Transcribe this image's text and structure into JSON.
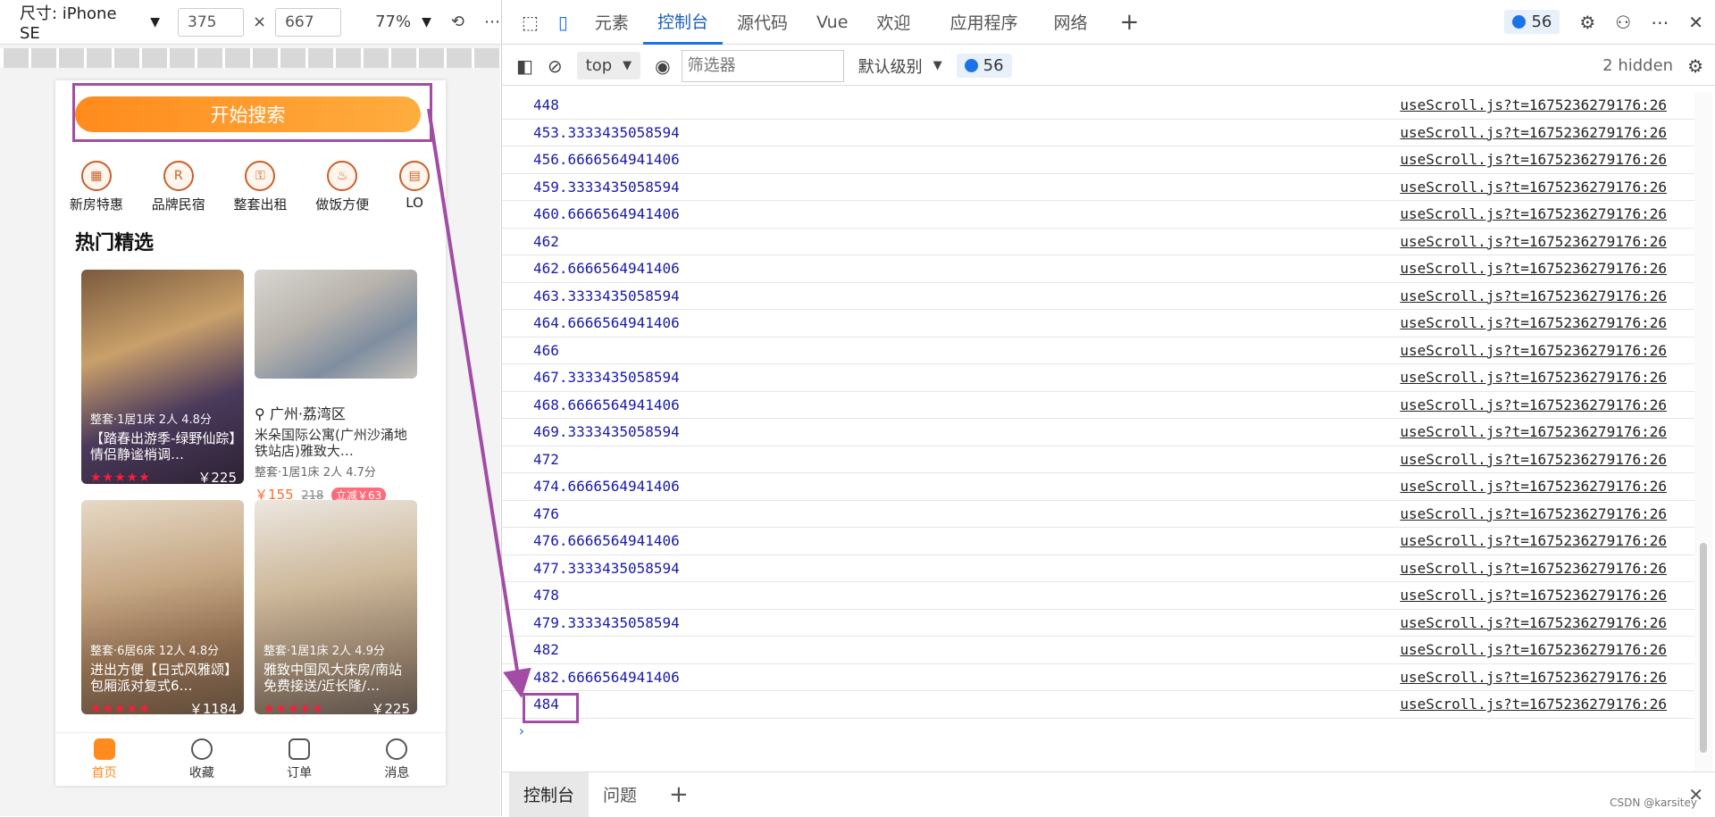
{
  "device_toolbar": {
    "dimensions_label": "尺寸: iPhone SE",
    "width": "375",
    "height": "667",
    "times": "×",
    "zoom": "77%"
  },
  "phone": {
    "search_button": "开始搜索",
    "categories": [
      {
        "label": "新房特惠",
        "icon": "building-icon"
      },
      {
        "label": "品牌民宿",
        "icon": "registered-icon"
      },
      {
        "label": "整套出租",
        "icon": "key-icon"
      },
      {
        "label": "做饭方便",
        "icon": "pot-icon"
      },
      {
        "label": "LO",
        "icon": "loft-icon"
      }
    ],
    "section_title": "热门精选",
    "cards": [
      {
        "meta": "整套·1居1床 2人 4.8分",
        "name": "【踏春出游季-绿野仙踪】情侣静谧梢调…",
        "stars": "★★★★★",
        "price": "￥225"
      },
      {
        "location": "广州·荔湾区",
        "name": "米朵国际公寓(广州沙涌地铁站店)雅致大…",
        "meta": "整套·1居1床 2人 4.7分",
        "price": "￥155",
        "old_price": "218",
        "discount": "立减￥63"
      },
      {
        "meta": "整套·6居6床 12人 4.8分",
        "name": "进出方便【日式风雅颂】包厢派对复式6…",
        "stars": "★★★★★",
        "price": "￥1184"
      },
      {
        "meta": "整套·1居1床 2人 4.9分",
        "name": "雅致中国风大床房/南站免费接送/近长隆/…",
        "stars": "★★★★★",
        "price": "￥225"
      }
    ],
    "tabs": [
      {
        "label": "首页"
      },
      {
        "label": "收藏"
      },
      {
        "label": "订单"
      },
      {
        "label": "消息"
      }
    ]
  },
  "devtools": {
    "tabs": [
      "元素",
      "控制台",
      "源代码",
      "Vue",
      "欢迎",
      "应用程序",
      "网络"
    ],
    "active_tab": "控制台",
    "issues_count": "56",
    "context": "top",
    "filter_placeholder": "筛选器",
    "levels": "默认级别",
    "hidden": "2 hidden",
    "source": "useScroll.js?t=1675236279176:26",
    "logs": [
      "448",
      "453.3333435058594",
      "456.6666564941406",
      "459.3333435058594",
      "460.6666564941406",
      "462",
      "462.6666564941406",
      "463.3333435058594",
      "464.6666564941406",
      "466",
      "467.3333435058594",
      "468.6666564941406",
      "469.3333435058594",
      "472",
      "474.6666564941406",
      "476",
      "476.6666564941406",
      "477.3333435058594",
      "478",
      "479.3333435058594",
      "482",
      "482.6666564941406",
      "484"
    ],
    "prompt": "›",
    "drawer_tabs": [
      "控制台",
      "问题"
    ],
    "watermark": "CSDN @karsitey"
  },
  "colors": {
    "accent_orange": "#ff8b1c",
    "highlight_purple": "#a24ca6",
    "devtools_blue": "#1a73e8",
    "log_value": "#1a1aa6"
  }
}
